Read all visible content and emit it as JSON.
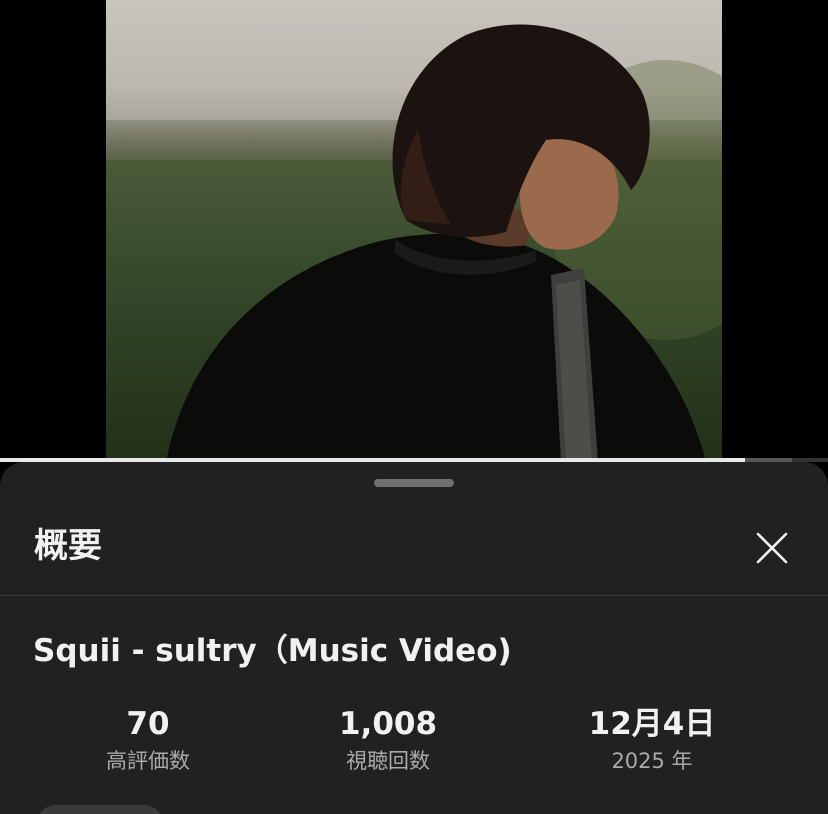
{
  "video": {
    "progress_fraction": 0.9
  },
  "sheet": {
    "title": "概要",
    "close_icon": "close-icon"
  },
  "details": {
    "title": "Squii - sultry（Music Video)"
  },
  "stats": {
    "likes_value": "70",
    "likes_label": "高評価数",
    "views_value": "1,008",
    "views_label": "視聴回数",
    "date_value": "12月4日",
    "date_label": "2025 年"
  },
  "colors": {
    "sheet_background": "#212121",
    "text_primary": "#f1f1f1",
    "text_secondary": "#aaaaaa"
  }
}
